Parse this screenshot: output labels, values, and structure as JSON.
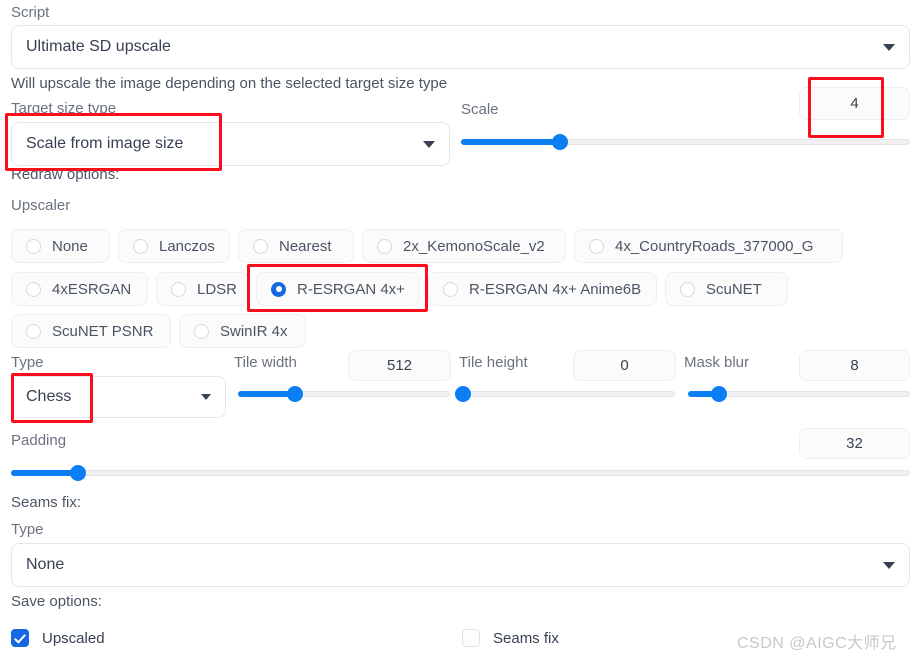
{
  "script": {
    "label": "Script",
    "value": "Ultimate SD upscale",
    "caret_icon": "chevron-down-icon"
  },
  "description": "Will upscale the image depending on the selected target size type",
  "target_size": {
    "label": "Target size type",
    "value": "Scale from image size",
    "caret_icon": "chevron-down-icon"
  },
  "scale": {
    "label": "Scale",
    "value": "4",
    "slider_percent": 22
  },
  "redraw": {
    "section_label": "Redraw options:",
    "upscaler_label": "Upscaler",
    "options": [
      {
        "label": "None",
        "checked": false
      },
      {
        "label": "Lanczos",
        "checked": false
      },
      {
        "label": "Nearest",
        "checked": false
      },
      {
        "label": "2x_KemonoScale_v2",
        "checked": false
      },
      {
        "label": "4x_CountryRoads_377000_G",
        "checked": false
      },
      {
        "label": "4xESRGAN",
        "checked": false
      },
      {
        "label": "LDSR",
        "checked": false
      },
      {
        "label": "R-ESRGAN 4x+",
        "checked": true
      },
      {
        "label": "R-ESRGAN 4x+ Anime6B",
        "checked": false
      },
      {
        "label": "ScuNET",
        "checked": false
      },
      {
        "label": "ScuNET PSNR",
        "checked": false
      },
      {
        "label": "SwinIR 4x",
        "checked": false
      }
    ]
  },
  "type": {
    "label": "Type",
    "value": "Chess",
    "caret_icon": "chevron-down-icon"
  },
  "tile_width": {
    "label": "Tile width",
    "value": "512",
    "slider_percent": 27
  },
  "tile_height": {
    "label": "Tile height",
    "value": "0",
    "slider_percent": 0
  },
  "mask_blur": {
    "label": "Mask blur",
    "value": "8",
    "slider_percent": 14
  },
  "padding": {
    "label": "Padding",
    "value": "32",
    "slider_percent": 7.5
  },
  "seams_fix": {
    "section_label": "Seams fix:",
    "type_label": "Type",
    "type_value": "None",
    "caret_icon": "chevron-down-icon"
  },
  "save_options": {
    "section_label": "Save options:",
    "upscaled": {
      "label": "Upscaled",
      "checked": true
    },
    "seams_fix": {
      "label": "Seams fix",
      "checked": false
    }
  },
  "watermark": "CSDN @AIGC大师兄",
  "colors": {
    "accent": "#0b7ef4",
    "checked": "#1569e0",
    "annotation": "#fc0d1b",
    "label": "#6b7280"
  }
}
